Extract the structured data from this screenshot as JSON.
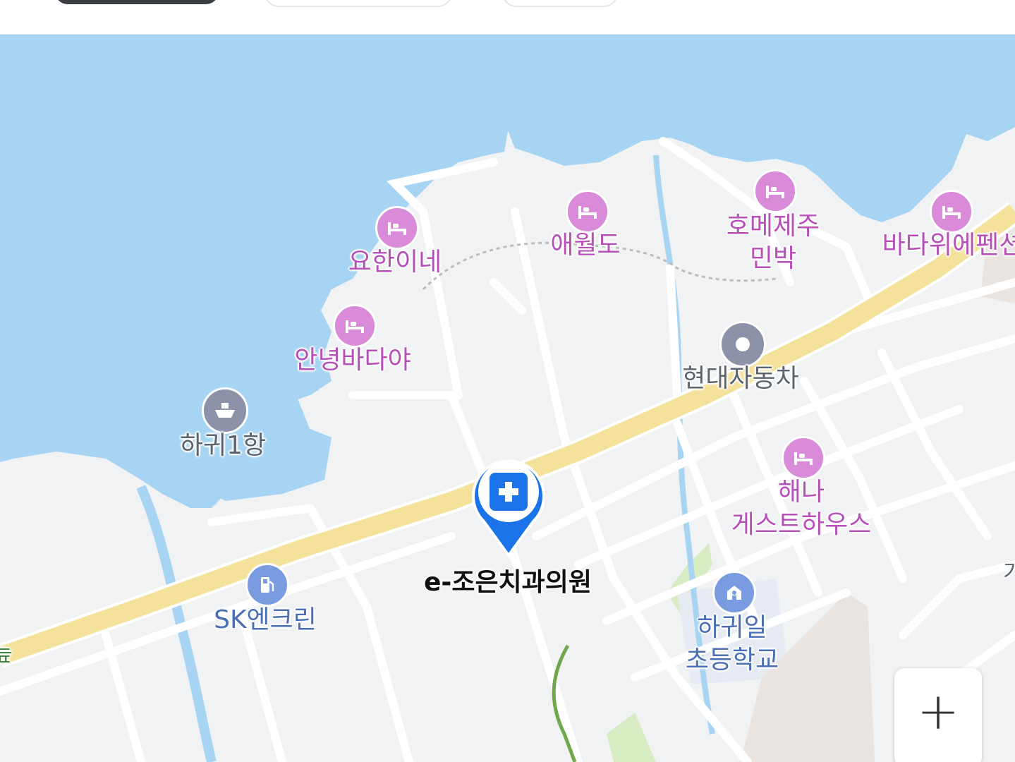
{
  "map": {
    "selected_place": {
      "name": "e-조은치과의원",
      "icon": "hospital-cross-icon",
      "accent_color": "#1a73e8"
    },
    "pois": [
      {
        "id": "yohanine",
        "name": "요한이네",
        "icon": "lodging-bed-icon"
      },
      {
        "id": "aewoldo",
        "name": "애월도",
        "icon": "lodging-bed-icon"
      },
      {
        "id": "homejeju",
        "name": "호메제주\n민박",
        "icon": "lodging-bed-icon"
      },
      {
        "id": "badawi",
        "name": "바다위에펜션",
        "icon": "lodging-bed-icon"
      },
      {
        "id": "annyeong",
        "name": "안녕바다야",
        "icon": "lodging-bed-icon"
      },
      {
        "id": "hagwi1",
        "name": "하귀1항",
        "icon": "ship-icon"
      },
      {
        "id": "hyundai",
        "name": "현대자동차",
        "icon": "dot-icon"
      },
      {
        "id": "haena",
        "name": "해나\n게스트하우스",
        "icon": "lodging-bed-icon"
      },
      {
        "id": "sk",
        "name": "SK엔크린",
        "icon": "gas-station-icon"
      },
      {
        "id": "hagwiil",
        "name": "하귀일\n초등학교",
        "icon": "school-icon"
      }
    ],
    "edge_labels": {
      "left": "늪",
      "right": "가"
    },
    "colors": {
      "sea": "#a6d4f2",
      "land": "#f1f2f4",
      "road": "#ffffff",
      "highway": "#f5e29a",
      "lodging": "#d98ad8",
      "transport": "#8c93a8",
      "green": "#d8ecc4"
    },
    "zoom_in_symbol": "+"
  }
}
